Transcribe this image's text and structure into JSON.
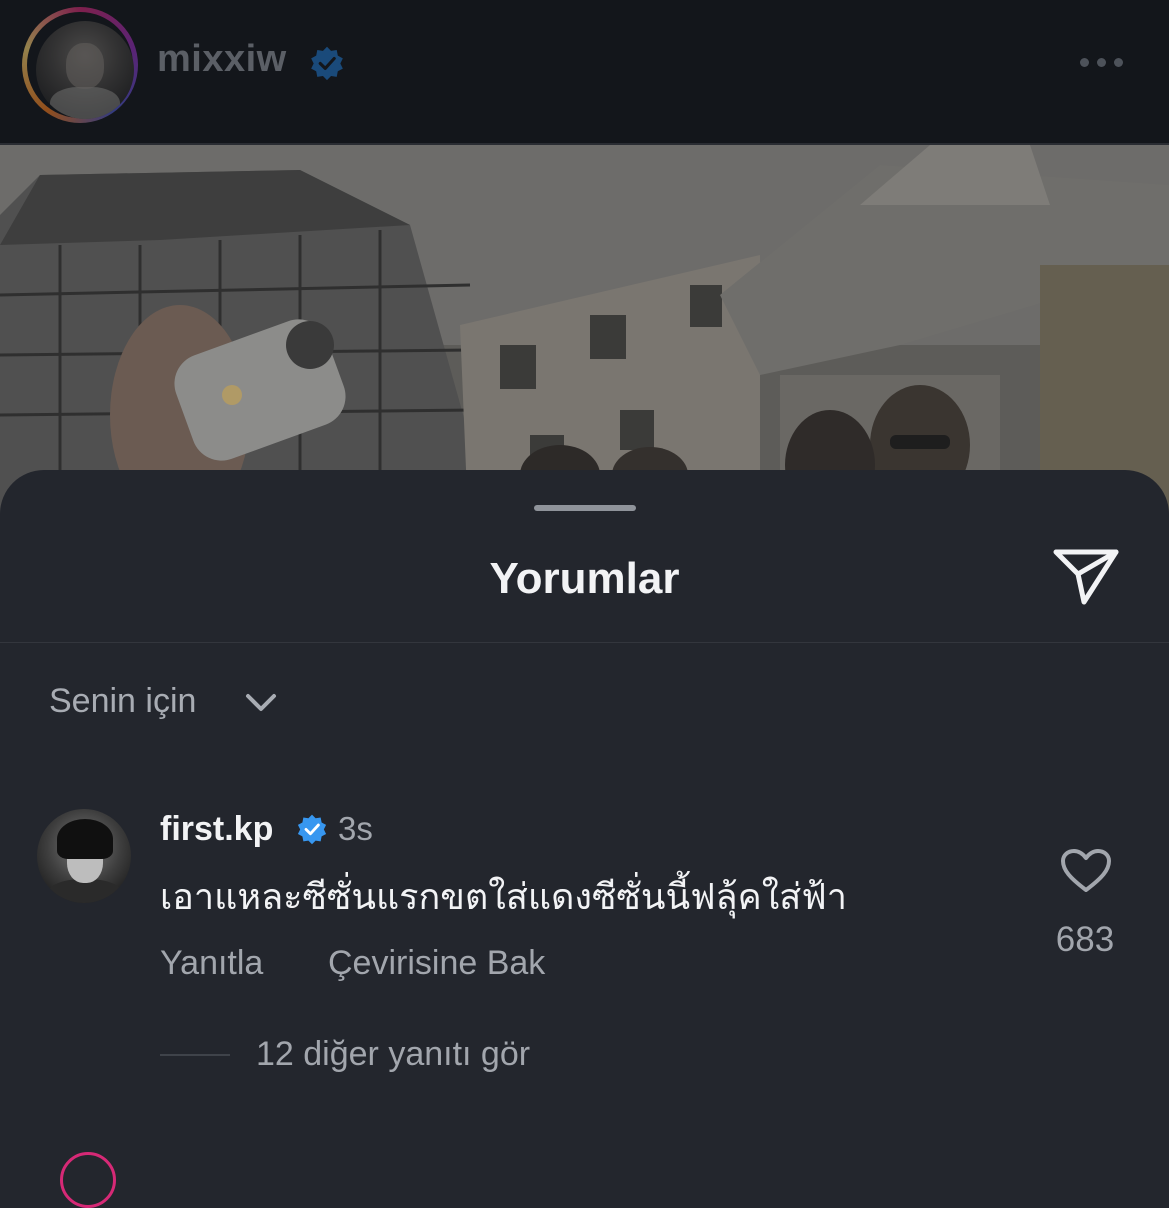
{
  "post_header": {
    "username": "mixxiw",
    "verified": true,
    "more_icon": "more-horizontal-icon"
  },
  "comments_sheet": {
    "title": "Yorumlar",
    "share_icon": "send-icon",
    "filter_label": "Senin için",
    "filter_icon": "chevron-down-icon"
  },
  "comment": {
    "username": "first.kp",
    "verified": true,
    "time": "3s",
    "text": "เอาแหละซีซั่นแรกขตใส่แดงซีซั่นนี้ฟลุ้คใส่ฟ้า",
    "reply_label": "Yanıtla",
    "translate_label": "Çevirisine Bak",
    "like_icon": "heart-icon",
    "like_count": "683",
    "view_replies_label": "12 diğer yanıtı gör"
  },
  "colors": {
    "verified_blue": "#3797f0",
    "background": "#23262d",
    "header_background": "#13161b"
  }
}
